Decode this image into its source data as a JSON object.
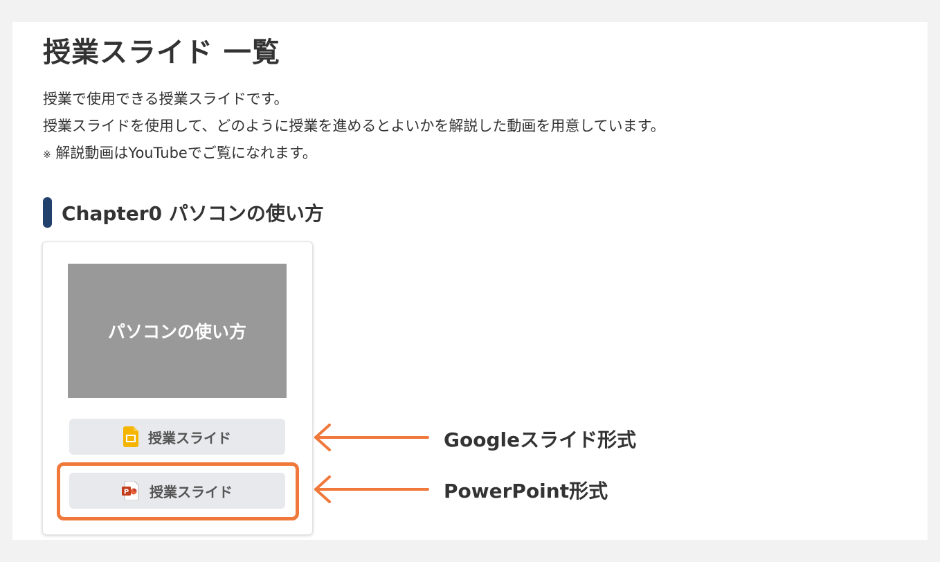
{
  "page": {
    "title": "授業スライド 一覧",
    "description_line1": "授業で使用できる授業スライドです。",
    "description_line2": "授業スライドを使用して、どのように授業を進めるとよいかを解説した動画を用意しています。",
    "note_mark": "※",
    "note_text": "解説動画はYouTubeでご覧になれます。"
  },
  "chapter": {
    "title": "Chapter0 パソコンの使い方",
    "accent_color": "#21406b"
  },
  "card": {
    "thumbnail_title": "パソコンの使い方",
    "google_button_label": "授業スライド",
    "google_icon": "google-slides-icon",
    "ppt_button_label": "授業スライド",
    "ppt_icon": "powerpoint-icon"
  },
  "annotations": {
    "google_label": "Googleスライド形式",
    "ppt_label": "PowerPoint形式",
    "highlight_color": "#f0783a"
  }
}
